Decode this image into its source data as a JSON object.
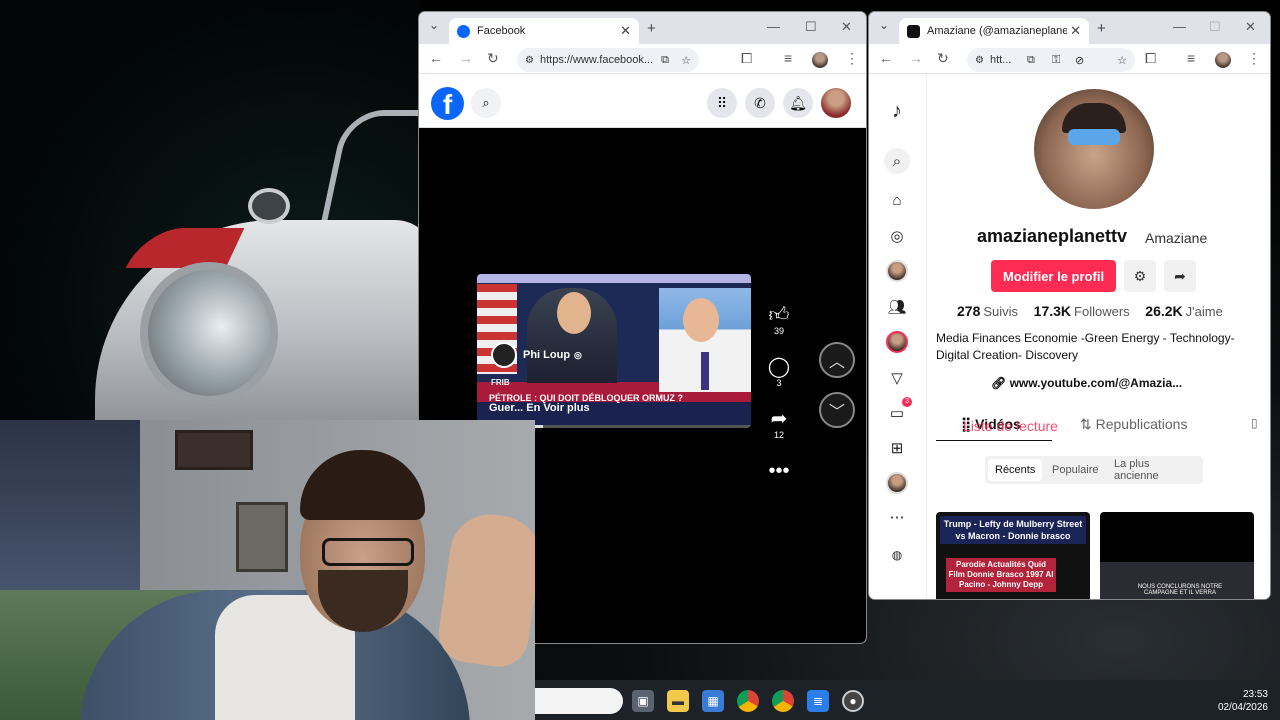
{
  "facebook_window": {
    "tab_title": "Facebook",
    "url": "https://www.facebook...",
    "video": {
      "author": "Phi Loup",
      "headline": "PÉTROLE : QUI DOIT DÉBLOQUER ORMUZ ?",
      "caption": "Guer... En Voir plus",
      "progress": 0.24,
      "bug_text": "FRIB"
    },
    "actions": {
      "likes": "39",
      "comments": "3",
      "shares": "12"
    }
  },
  "tiktok_window": {
    "tab_title": "Amaziane (@amazianeplanettv)",
    "url": "htt...",
    "profile": {
      "username": "amazianeplanettv",
      "nickname": "Amaziane",
      "edit_label": "Modifier le profil",
      "following_count": "278",
      "following_label": "Suivis",
      "followers_count": "17.3K",
      "followers_label": "Followers",
      "likes_count": "26.2K",
      "likes_label": "J'aime",
      "bio": "Media Finances Economie -Green Energy - Technology- Digital Creation- Discovery",
      "link": "www.youtube.com/@Amazia..."
    },
    "tabs": {
      "videos": "Vidéos",
      "playlist": "Liste de lecture",
      "reposts": "Republications"
    },
    "filters": [
      "Récents",
      "Populaire",
      "La plus ancienne"
    ],
    "inbox_badge": "3",
    "thumbnails": [
      {
        "title": "Trump - Lefty de Mulberry Street vs Macron - Donnie brasco",
        "subtitle": "Parodie Actualités Quid Film Donnie Brasco 1997 Al Pacino - Johnny Depp"
      },
      {
        "title": "",
        "subtitle": "NOUS CONCLURONS NOTRE CAMPAGNE ET IL VERRA"
      }
    ]
  },
  "taskbar": {
    "time": "23:53",
    "date": "02/04/2026"
  },
  "colors": {
    "facebook_blue": "#0866ff",
    "tiktok_red": "#fe2c55"
  }
}
